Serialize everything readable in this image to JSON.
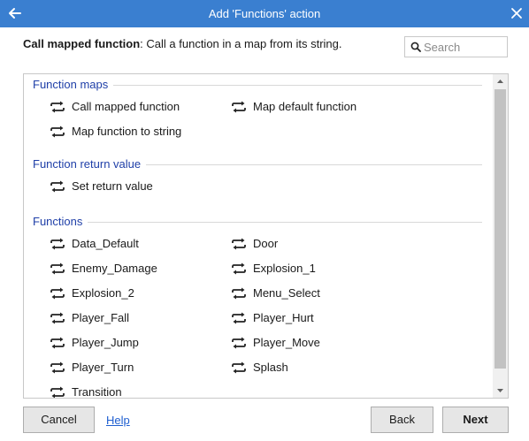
{
  "window": {
    "title": "Add 'Functions' action",
    "back_icon": "arrow-left-icon",
    "close_icon": "close-icon",
    "titlebar_color": "#3a7fd0"
  },
  "description": {
    "name": "Call mapped function",
    "text": ": Call a function in a map from its string."
  },
  "search": {
    "placeholder": "Search",
    "value": "",
    "icon": "search-icon"
  },
  "groups": [
    {
      "header": "Function maps",
      "items": [
        "Call mapped function",
        "Map default function",
        "Map function to string"
      ]
    },
    {
      "header": "Function return value",
      "items": [
        "Set return value"
      ]
    },
    {
      "header": "Functions",
      "items": [
        "Data_Default",
        "Door",
        "Enemy_Damage",
        "Explosion_1",
        "Explosion_2",
        "Menu_Select",
        "Player_Fall",
        "Player_Hurt",
        "Player_Jump",
        "Player_Move",
        "Player_Turn",
        "Splash",
        "Transition"
      ]
    }
  ],
  "item_icon": "repeat-arrows-icon",
  "buttons": {
    "cancel": "Cancel",
    "help": "Help",
    "back": "Back",
    "next": "Next"
  },
  "colors": {
    "group_header": "#1f3fa8",
    "link": "#1f5fd0"
  }
}
